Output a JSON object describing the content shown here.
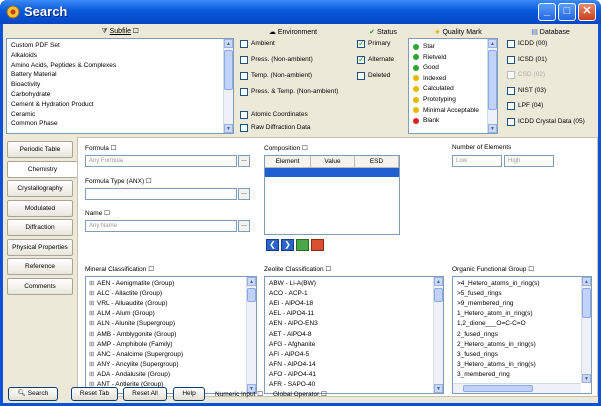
{
  "window": {
    "title": "Search"
  },
  "subfile": {
    "header": "Subfile",
    "items": [
      "Custom PDF Set",
      "Alkaloids",
      "Amino Acids, Peptides & Complexes",
      "Battery Material",
      "Bioactivity",
      "Carbohydrate",
      "Cement & Hydration Product",
      "Ceramic",
      "Common Phase"
    ]
  },
  "environment": {
    "header": "Environment",
    "items": [
      "Ambient",
      "Press. (Non-ambient)",
      "Temp. (Non-ambient)",
      "Press. & Temp. (Non-ambient)"
    ],
    "extra": [
      "Atomic Coordinates",
      "Raw Diffraction Data"
    ]
  },
  "status": {
    "header": "Status",
    "items": [
      {
        "label": "Primary",
        "checked": true
      },
      {
        "label": "Alternate",
        "checked": true
      },
      {
        "label": "Deleted",
        "checked": false
      }
    ]
  },
  "quality": {
    "header": "Quality Mark",
    "items": [
      {
        "label": "Star",
        "color": "#2ea52e"
      },
      {
        "label": "Rietveld",
        "color": "#2ea52e"
      },
      {
        "label": "Good",
        "color": "#2ea52e"
      },
      {
        "label": "Indexed",
        "color": "#e6b800"
      },
      {
        "label": "Calculated",
        "color": "#e6b800"
      },
      {
        "label": "Prototyping",
        "color": "#e6b800"
      },
      {
        "label": "Minimal Acceptable",
        "color": "#e6b800"
      },
      {
        "label": "Blank",
        "color": "#d62222"
      }
    ]
  },
  "database": {
    "header": "Database",
    "items": [
      {
        "label": "ICDD (00)",
        "disabled": false
      },
      {
        "label": "ICSD (01)",
        "disabled": false
      },
      {
        "label": "CSD (02)",
        "disabled": true
      },
      {
        "label": "NIST (03)",
        "disabled": false
      },
      {
        "label": "LPF (04)",
        "disabled": false
      },
      {
        "label": "ICDD Crystal Data (05)",
        "disabled": false
      }
    ]
  },
  "tabs": [
    "Periodic Table",
    "Chemistry",
    "Crystallography",
    "Modulated",
    "Diffraction",
    "Physical Properties",
    "Reference",
    "Comments"
  ],
  "chemistry": {
    "formula_label": "Formula",
    "formula_placeholder": "Any Formula",
    "formula_type_label": "Formula Type (ANX)",
    "name_label": "Name",
    "name_placeholder": "Any Name",
    "composition_label": "Composition",
    "composition_cols": [
      "Element",
      "Value",
      "ESD"
    ],
    "num_elements_label": "Number of Elements",
    "low_placeholder": "Low",
    "high_placeholder": "High"
  },
  "mineral": {
    "header": "Mineral Classification",
    "items": [
      "AEN - Aenigmatite  (Group)",
      "ALC - Allactite  (Group)",
      "VRL - Alluaudite  (Group)",
      "ALM - Alum  (Group)",
      "ALN - Alunite  (Supergroup)",
      "AMB - Amblygonite  (Group)",
      "AMP - Amphibole  (Family)",
      "ANC - Analcime  (Supergroup)",
      "ANY - Ancylite  (Supergroup)",
      "ADA - Andalusite  (Group)",
      "ANT - Antlerite  (Group)"
    ]
  },
  "zeolite": {
    "header": "Zeolite Classification",
    "items": [
      "ABW - Li-A(BW)",
      "ACO - ACP-1",
      "AEI - AlPO4-18",
      "AEL - AlPO4-11",
      "AEN - AlPO-EN3",
      "AET - AlPO4-8",
      "AFG - Afghanite",
      "AFI - AlPO4-5",
      "AFN - AlPO4-14",
      "AFO - AlPO4-41",
      "AFR - SAPO-40"
    ]
  },
  "organic": {
    "header": "Organic Functional Group",
    "items": [
      ">4_Hetero_atoms_in_ring(s)",
      ">5_fused_rings",
      ">9_membered_ring",
      "1_Hetero_atom_in_ring(s)",
      "1,2_dione___O=C-C=O",
      "2_fused_rings",
      "2_Hetero_atoms_in_ring(s)",
      "3_fused_rings",
      "3_Hetero_atoms_in_ring(s)",
      "3_membered_ring"
    ]
  },
  "footer": {
    "search": "Search",
    "reset_tab": "Reset Tab",
    "reset_all": "Reset All",
    "help": "Help",
    "numeric_input": "Numeric Input",
    "global_operator": "Global Operator"
  }
}
